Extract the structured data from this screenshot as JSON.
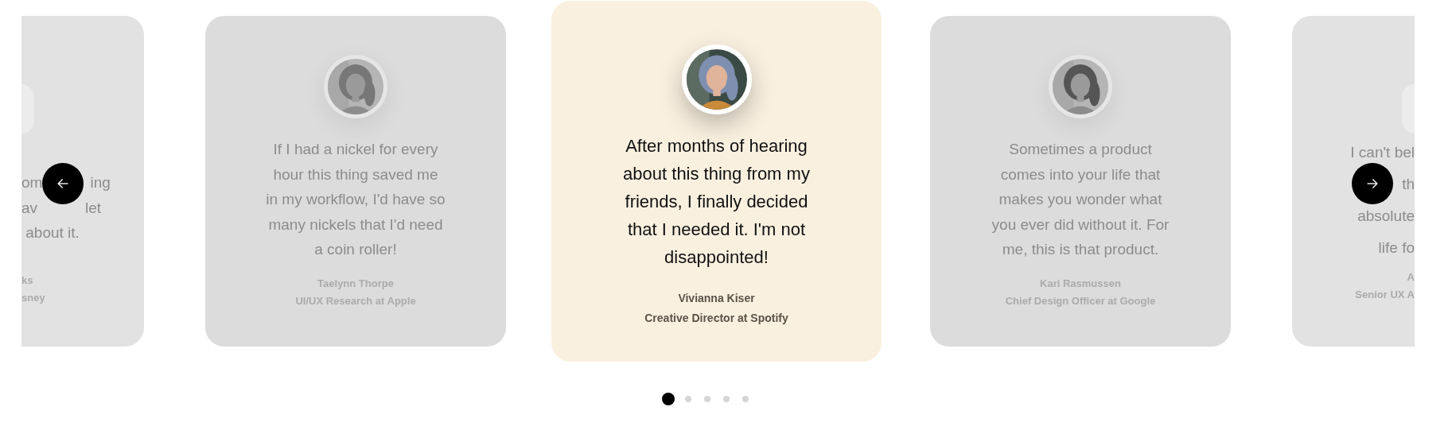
{
  "carousel": {
    "cards": [
      {
        "kind": "clipped_left",
        "selected": false,
        "quote_lines": [
          [
            "om",
            "ing"
          ],
          [
            "av",
            "let"
          ],
          [
            " about it."
          ]
        ],
        "name": "ks",
        "role": "sney"
      },
      {
        "kind": "full",
        "selected": false,
        "quote_lines": [
          "If I had a nickel for every",
          "hour this thing saved me",
          "in my workflow, I'd have so",
          "many nickels that I'd need",
          "a coin roller!"
        ],
        "name": "Taelynn Thorpe",
        "role": "UI/UX Research at Apple"
      },
      {
        "kind": "full",
        "selected": true,
        "quote_lines": [
          "After months of hearing",
          "about this thing from my",
          "friends, I finally decided",
          "that I needed it. I'm not",
          "disappointed!"
        ],
        "name": "Vivianna Kiser",
        "role": "Creative Director at Spotify"
      },
      {
        "kind": "full",
        "selected": false,
        "quote_lines": [
          "Sometimes a product",
          "comes into your life that",
          "makes you wonder what",
          "you ever did without it. For",
          "me, this is that product."
        ],
        "name": "Kari Rasmussen",
        "role": "Chief Design Officer at Google"
      },
      {
        "kind": "clipped_right",
        "selected": false,
        "quote_lines": [
          [
            "I can't bel"
          ],
          [
            "th"
          ],
          [
            "absolute"
          ],
          [
            "life fo"
          ]
        ],
        "name": "A",
        "role": "Senior UX A"
      }
    ],
    "dots": [
      {
        "selected": true
      },
      {
        "selected": false
      },
      {
        "selected": false
      },
      {
        "selected": false
      },
      {
        "selected": false
      }
    ]
  }
}
